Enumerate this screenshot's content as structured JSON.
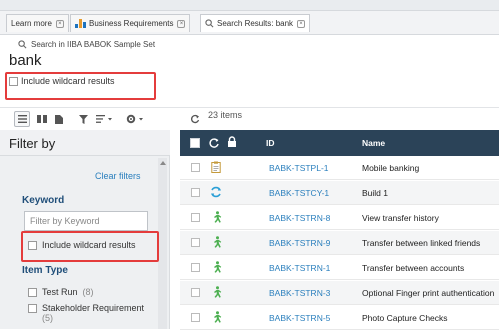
{
  "tabs": [
    {
      "label": "Learn more"
    },
    {
      "label": "Business Requirements"
    },
    {
      "label": "Search Results: bank"
    }
  ],
  "search": {
    "scope_label": "Search in IIBA BABOK Sample Set",
    "query": "bank",
    "wildcard_label": "Include wildcard results"
  },
  "toolbar": {
    "item_count": "23 items"
  },
  "filter": {
    "header": "Filter by",
    "clear_label": "Clear filters",
    "keyword_heading": "Keyword",
    "keyword_placeholder": "Filter by Keyword",
    "wildcard_label": "Include wildcard results",
    "item_type_heading": "Item Type",
    "item_types": [
      {
        "label": "Test Run",
        "count": "(8)"
      },
      {
        "label": "Stakeholder Requirement",
        "count": "(5)"
      }
    ]
  },
  "grid": {
    "columns": {
      "id": "ID",
      "name": "Name"
    },
    "rows": [
      {
        "icon": "clipboard-icon",
        "id": "BABK-TSTPL-1",
        "name": "Mobile banking"
      },
      {
        "icon": "cycle-icon",
        "id": "BABK-TSTCY-1",
        "name": "Build 1"
      },
      {
        "icon": "run-icon",
        "id": "BABK-TSTRN-8",
        "name": "View transfer history"
      },
      {
        "icon": "run-icon",
        "id": "BABK-TSTRN-9",
        "name": "Transfer between linked friends"
      },
      {
        "icon": "run-icon",
        "id": "BABK-TSTRN-1",
        "name": "Transfer between accounts"
      },
      {
        "icon": "run-icon",
        "id": "BABK-TSTRN-3",
        "name": "Optional Finger print authentication"
      },
      {
        "icon": "run-icon",
        "id": "BABK-TSTRN-5",
        "name": "Photo Capture Checks"
      }
    ]
  },
  "colors": {
    "header_bg": "#2b4358",
    "link": "#2a7fbd",
    "highlight": "#e43c3c",
    "run_icon": "#4caf50",
    "cycle_icon": "#2a9fd6"
  }
}
